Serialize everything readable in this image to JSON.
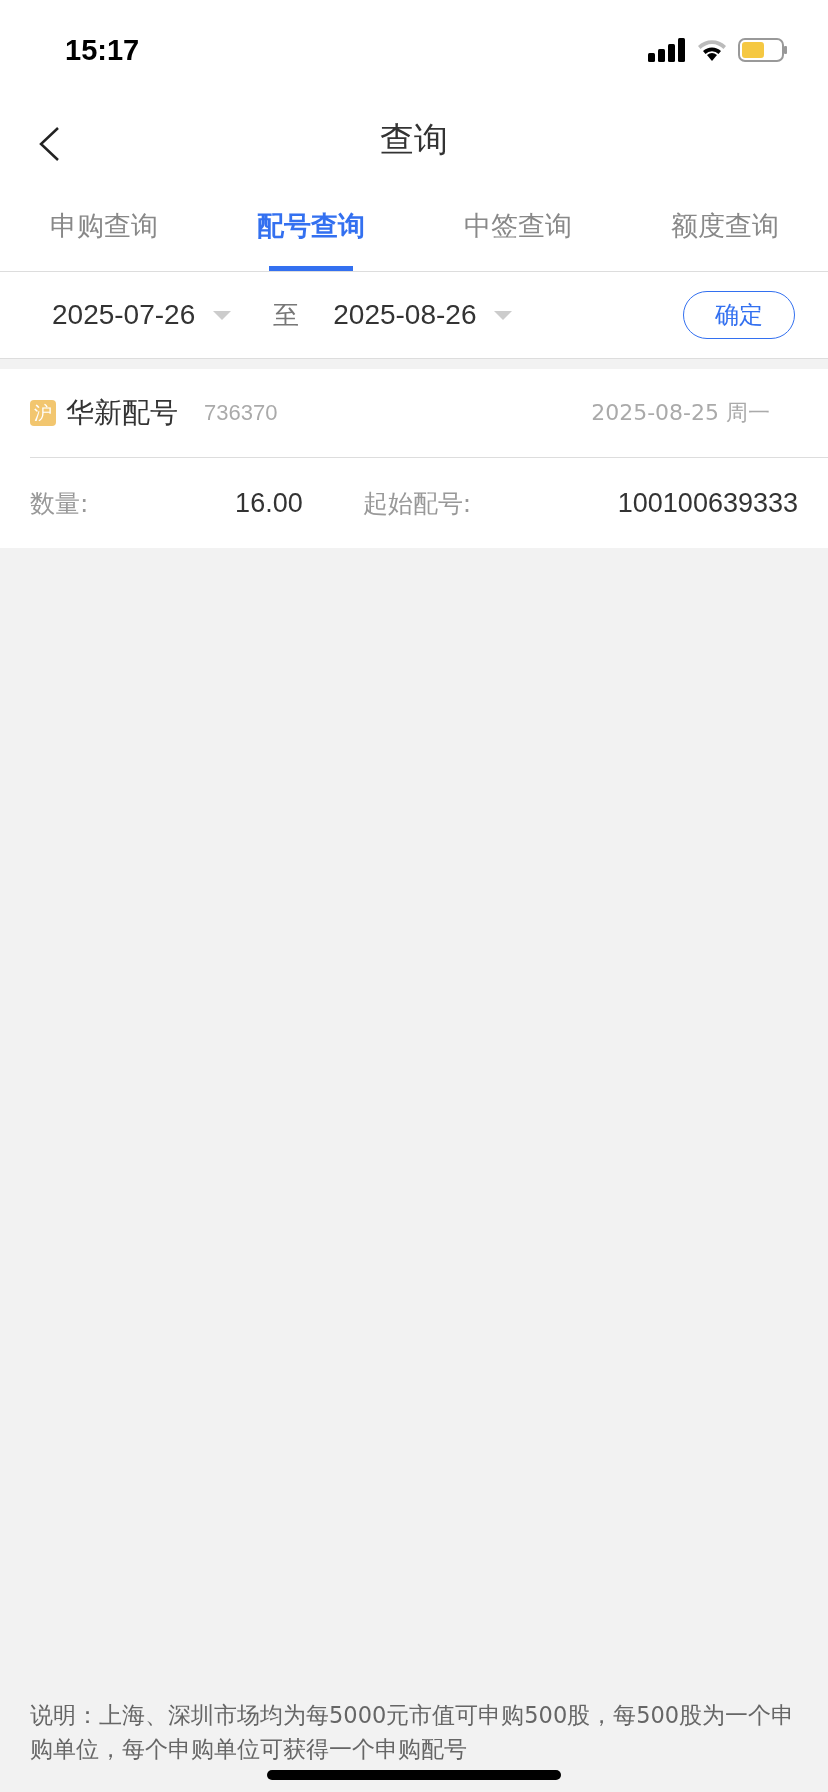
{
  "status_bar": {
    "time": "15:17"
  },
  "header": {
    "title": "查询"
  },
  "tabs": [
    {
      "label": "申购查询",
      "selected": false
    },
    {
      "label": "配号查询",
      "selected": true
    },
    {
      "label": "中签查询",
      "selected": false
    },
    {
      "label": "额度查询",
      "selected": false
    }
  ],
  "date_range": {
    "start": "2025-07-26",
    "separator": "至",
    "end": "2025-08-26",
    "confirm": "确定"
  },
  "records": [
    {
      "market": "沪",
      "name": "华新配号",
      "code": "736370",
      "date": "2025-08-25 周一",
      "quantity_label": "数量:",
      "quantity": "16.00",
      "start_label": "起始配号:",
      "start_number": "100100639333"
    }
  ],
  "note": "说明：上海、深圳市场均为每5000元市值可申购500股，每500股为一个申购单位，每个申购单位可获得一个申购配号"
}
